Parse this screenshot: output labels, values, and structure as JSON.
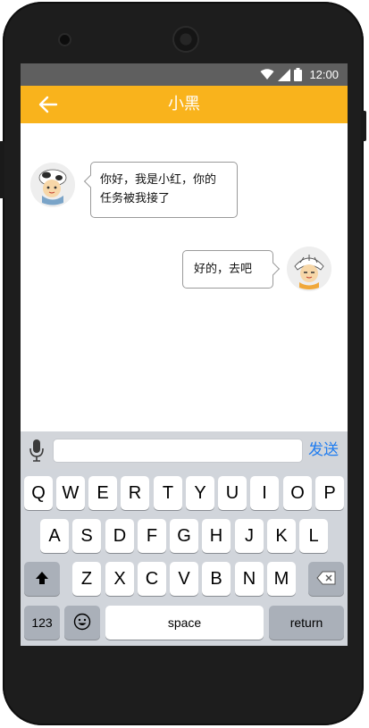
{
  "status_bar": {
    "time": "12:00"
  },
  "app_bar": {
    "title": "小黑"
  },
  "messages": [
    {
      "side": "left",
      "lines": [
        "你好，我是小红，你的",
        "任务被我接了"
      ]
    },
    {
      "side": "right",
      "lines": [
        "好的，去吧"
      ]
    }
  ],
  "input": {
    "value": "",
    "placeholder": "",
    "send_label": "发送"
  },
  "keyboard": {
    "row1": [
      "Q",
      "W",
      "E",
      "R",
      "T",
      "Y",
      "U",
      "I",
      "O",
      "P"
    ],
    "row2": [
      "A",
      "S",
      "D",
      "F",
      "G",
      "H",
      "J",
      "K",
      "L"
    ],
    "row3": [
      "Z",
      "X",
      "C",
      "V",
      "B",
      "N",
      "M"
    ],
    "numbers_label": "123",
    "space_label": "space",
    "return_label": "return"
  },
  "colors": {
    "app_bar": "#f9b31c",
    "status_bar": "#5f5f5f",
    "send": "#1e7cf0",
    "keyboard_bg": "#d1d5db"
  },
  "icons": {
    "back": "arrow-left-icon",
    "wifi": "wifi-icon",
    "signal": "cell-signal-icon",
    "battery": "battery-icon",
    "mic": "microphone-icon",
    "shift": "shift-arrow-icon",
    "delete": "backspace-icon",
    "emoji": "emoji-icon"
  }
}
